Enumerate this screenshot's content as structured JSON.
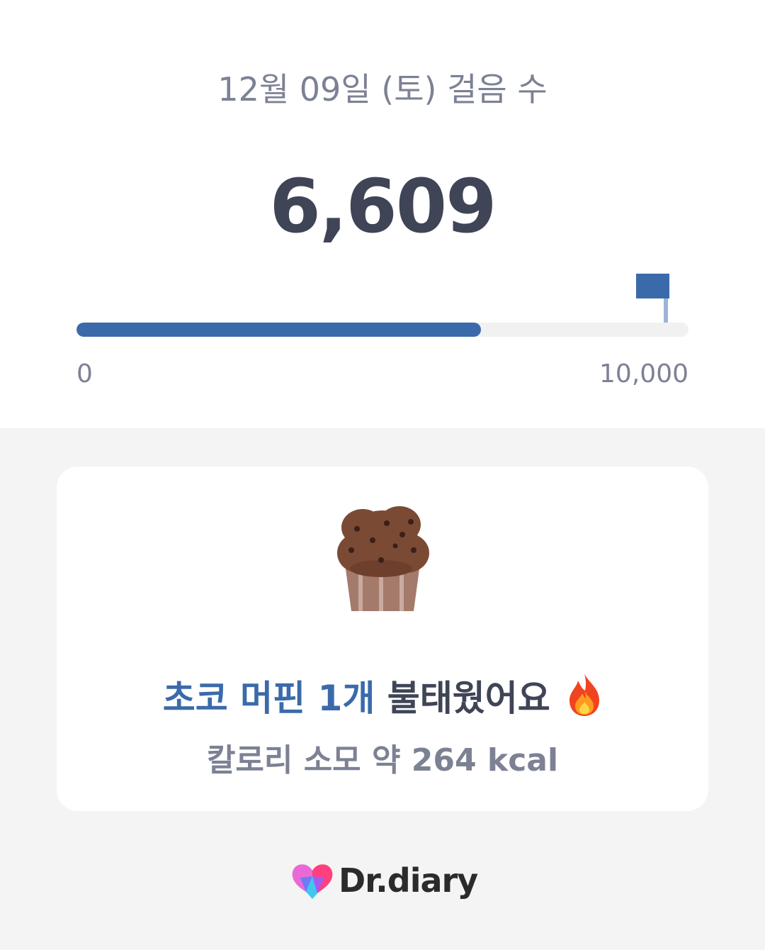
{
  "summary": {
    "date_title": "12월 09일 (토) 걸음 수",
    "steps": "6,609",
    "progress_fraction": 0.6609
  },
  "progress": {
    "min_label": "0",
    "max_label": "10,000",
    "fill_color": "#3b6aaa",
    "goal_icon": "flag-icon"
  },
  "card": {
    "food_icon": "muffin-icon",
    "headline_accent": "초코 머핀 1개",
    "headline_rest": "불태웠어요",
    "headline_icon": "fire-icon",
    "subline": "칼로리 소모 약 264 kcal"
  },
  "brand": {
    "name": "Dr.diary",
    "logo_icon": "heart-logo-icon"
  },
  "colors": {
    "accent": "#3b6aaa",
    "text_dark": "#3f4556",
    "text_muted": "#7c8194",
    "background": "#f4f4f4"
  }
}
